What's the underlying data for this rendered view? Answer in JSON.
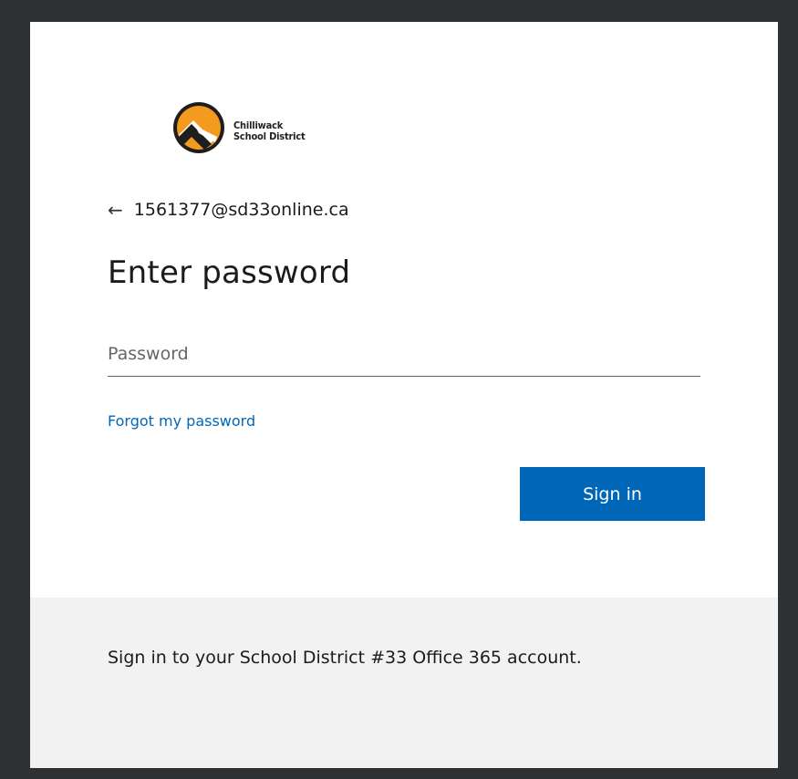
{
  "logo": {
    "line1": "Chilliwack",
    "line2": "School District",
    "icon": "mountain-logo-icon",
    "colors": {
      "circle": "#1e1e1e",
      "sun": "#f39a1f",
      "mountain": "#ffffff"
    }
  },
  "back": {
    "icon": "arrow-left-icon",
    "arrow": "←",
    "email": "1561377@sd33online.ca"
  },
  "title": "Enter password",
  "password": {
    "placeholder": "Password",
    "value": ""
  },
  "forgot_link": "Forgot my password",
  "signin_label": "Sign in",
  "footer_text": "Sign in to your School District #33 Office 365 account.",
  "colors": {
    "accent": "#0067b8",
    "footer_bg": "#f2f2f2",
    "frame_bg": "#2f3234"
  }
}
